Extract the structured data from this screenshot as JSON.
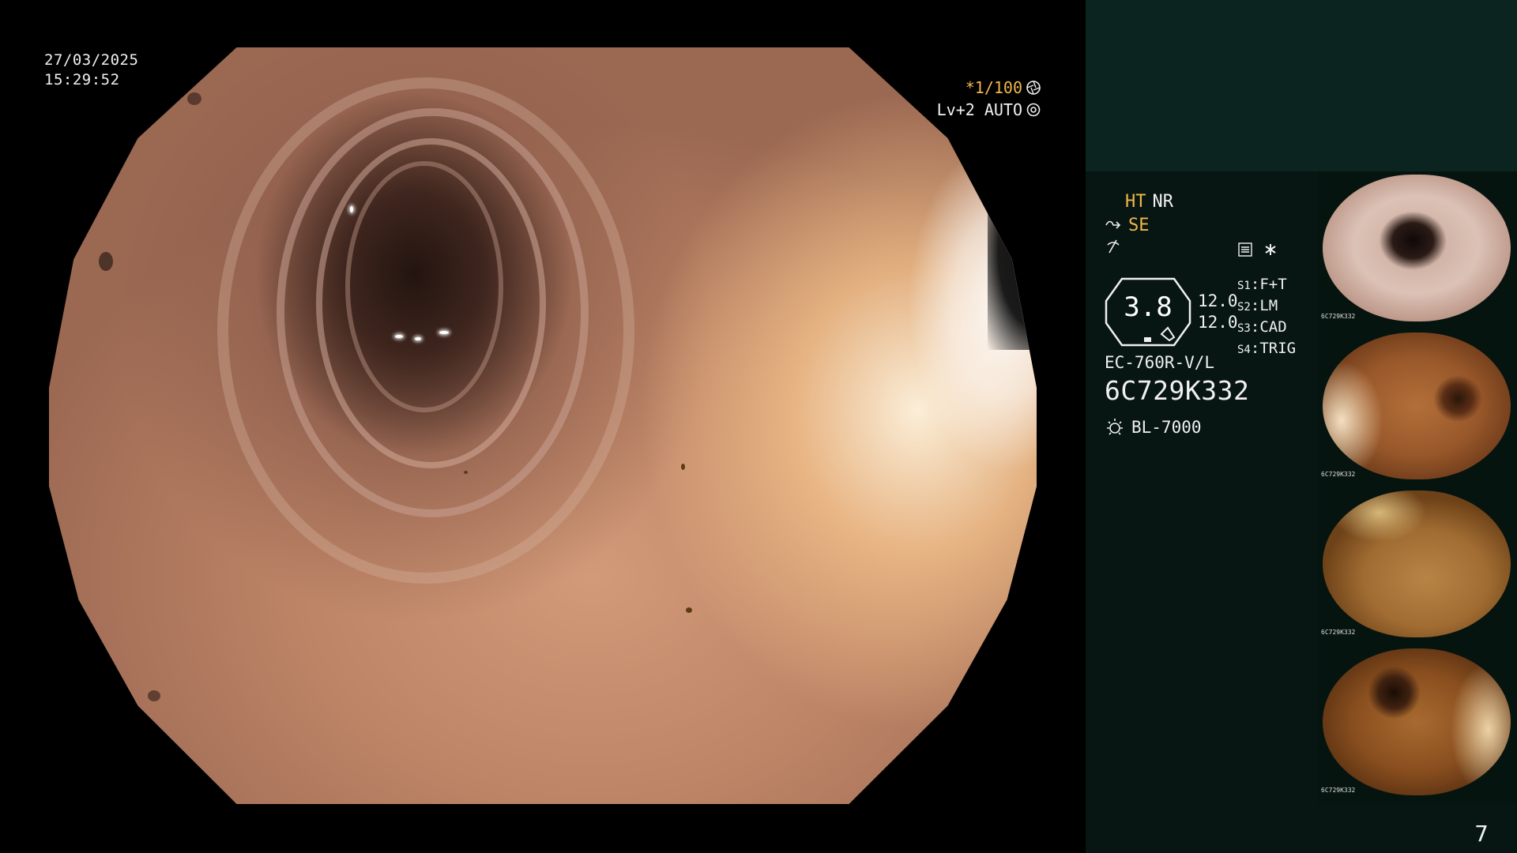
{
  "overlay": {
    "date": "27/03/2025",
    "time": "15:29:52",
    "shutter": "*1/100",
    "level": "Lv+2 AUTO"
  },
  "panel": {
    "ht": "HT",
    "nr": "NR",
    "se": "SE",
    "octagon_value": "3.8",
    "enhancement": [
      "12.0",
      "12.0"
    ],
    "switches": [
      {
        "key": "S1",
        "value": "F+T"
      },
      {
        "key": "S2",
        "value": "LM"
      },
      {
        "key": "S3",
        "value": "CAD"
      },
      {
        "key": "S4",
        "value": "TRIG"
      }
    ],
    "scope_model": "EC-760R-V/L",
    "serial": "6C729K332",
    "light_source": "BL-7000",
    "page_number": "7"
  },
  "thumbnails": [
    {
      "caption": "6C729K332"
    },
    {
      "caption": "6C729K332"
    },
    {
      "caption": "6C729K332"
    },
    {
      "caption": "6C729K332"
    }
  ],
  "colors": {
    "accent": "#f2b84a",
    "panel_top": "#0b2420",
    "panel_bottom": "#071613"
  },
  "icons": [
    "aperture-icon",
    "gear-icon",
    "se-icon",
    "flash-icon",
    "menu-icon",
    "star-icon",
    "light-source-icon"
  ]
}
